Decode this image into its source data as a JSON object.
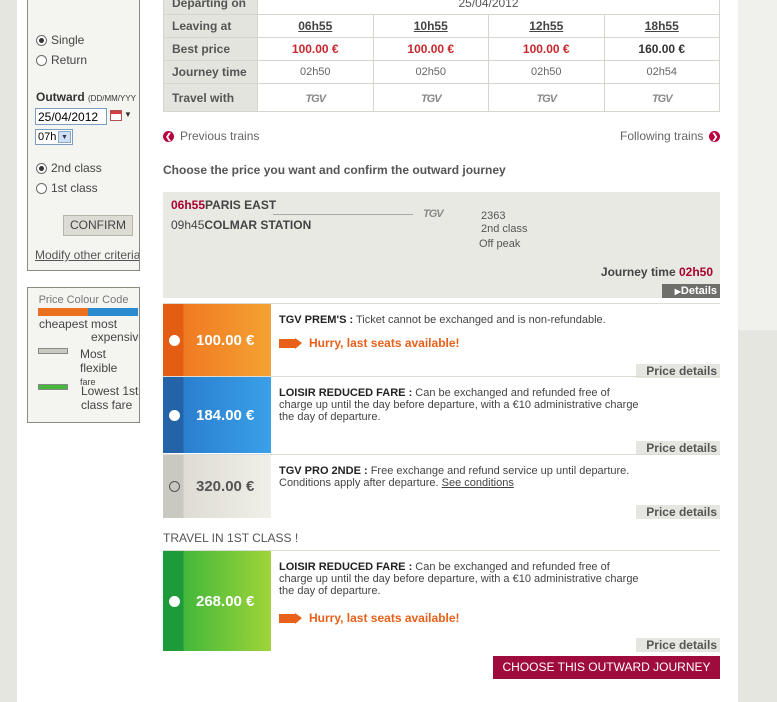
{
  "search": {
    "trip_single": "Single",
    "trip_return": "Return",
    "outward_label": "Outward",
    "outward_format": "(DD/MM/YYY",
    "outward_date": "25/04/2012",
    "outward_time": "07h",
    "class_2nd": "2nd class",
    "class_1st": "1st class",
    "confirm_label": "CONFIRM",
    "modify_label": "Modify other criteria"
  },
  "legend": {
    "title": "Price Colour Code",
    "cheapest": "cheapest most",
    "expensive": "expensive",
    "most": "Most",
    "flexible": "flexible",
    "fare": "fare",
    "lowest": "Lowest 1st",
    "class_fare": "class fare",
    "colors": {
      "cheap": "#e8701e",
      "expensive": "#2a8ad0",
      "flexible": "#c9c9c1",
      "first": "#43b83a"
    }
  },
  "timetable": {
    "departing_label": "Departing on",
    "departing_date": "25/04/2012",
    "leaving_label": "Leaving at",
    "best_price_label": "Best price",
    "journey_time_label": "Journey time",
    "travel_with_label": "Travel with",
    "operator": "TGV",
    "trains": [
      {
        "leaving": "06h55",
        "price": "100.00 €",
        "journey_time": "02h50"
      },
      {
        "leaving": "10h55",
        "price": "100.00 €",
        "journey_time": "02h50"
      },
      {
        "leaving": "12h55",
        "price": "100.00 €",
        "journey_time": "02h50"
      },
      {
        "leaving": "18h55",
        "price": "160.00 €",
        "journey_time": "02h54"
      }
    ]
  },
  "nav": {
    "previous": "Previous trains",
    "following": "Following trains"
  },
  "instructions": "Choose the price you want and confirm the outward journey",
  "journey": {
    "dep_time": "06h55",
    "dep_station": "PARIS EAST",
    "arr_time": "09h45",
    "arr_station": "COLMAR STATION",
    "operator": "TGV",
    "train_number": "2363",
    "class": "2nd class",
    "period": "Off peak",
    "journey_time_label": "Journey time",
    "journey_time": "02h50",
    "details_label": "Details"
  },
  "fares": [
    {
      "price": "100.00 €",
      "name": "TGV PREM'S :",
      "desc": "Ticket cannot be exchanged and is non-refundable.",
      "hurry": "Hurry, last seats available!",
      "price_details": "Price details"
    },
    {
      "price": "184.00 €",
      "name": "LOISIR REDUCED FARE :",
      "desc": "Can be exchanged and refunded free of charge up until the day before departure, with a €10 administrative charge the day of departure.",
      "price_details": "Price details"
    },
    {
      "price": "320.00 €",
      "name": "TGV PRO 2NDE :",
      "desc": "Free exchange and refund service up until departure. Conditions apply after departure.",
      "link": "See conditions",
      "price_details": "Price details"
    }
  ],
  "first_class": {
    "title": "TRAVEL IN 1ST CLASS !",
    "fare": {
      "price": "268.00 €",
      "name": "LOISIR REDUCED FARE :",
      "desc": "Can be exchanged and refunded free of charge up until the day before departure, with a €10 administrative charge the day of departure.",
      "hurry": "Hurry, last seats available!",
      "price_details": "Price details"
    }
  },
  "choose_label": "CHOOSE THIS OUTWARD JOURNEY"
}
